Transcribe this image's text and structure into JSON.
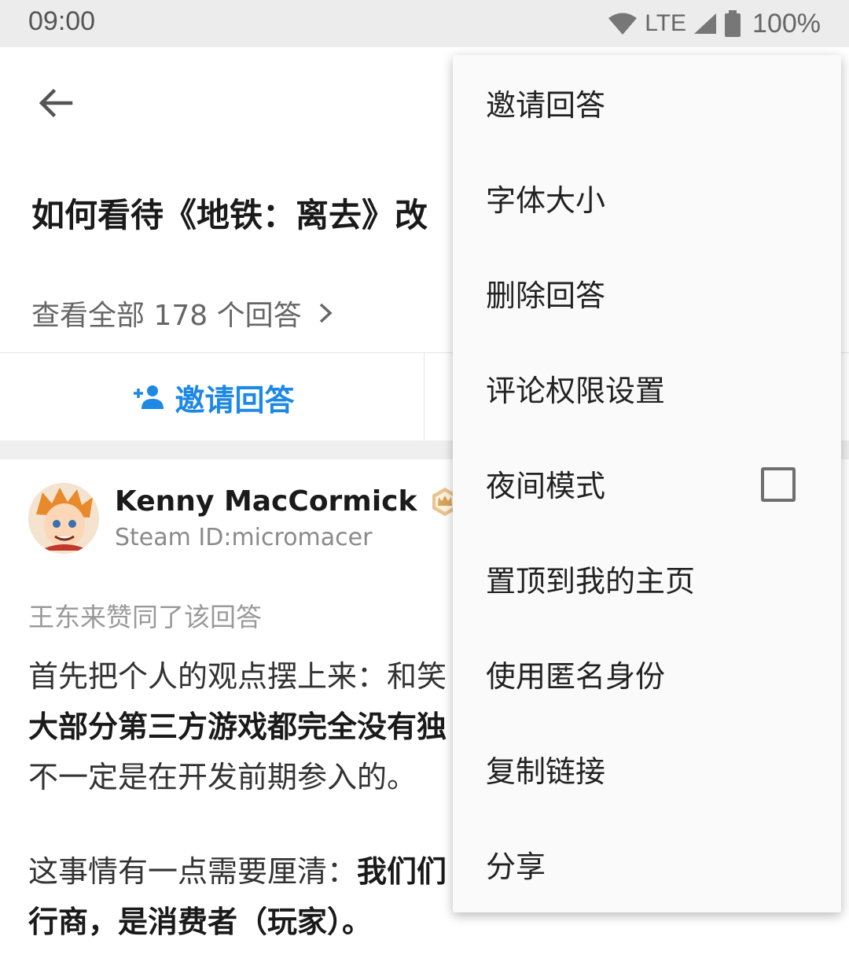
{
  "status_bar": {
    "time": "09:00",
    "network": "LTE",
    "battery": "100%"
  },
  "question": {
    "title": "如何看待《地铁：离去》改",
    "view_all": "查看全部 178 个回答"
  },
  "actions": {
    "invite_label": "邀请回答",
    "accent_color": "#1e88e5"
  },
  "author": {
    "name": "Kenny MacCormick",
    "bio": "Steam ID:micromacer"
  },
  "answer": {
    "voter_line": "王东来赞同了该回答",
    "paragraph1_line1": "首先把个人的观点摆上来：和笑",
    "paragraph1_line2": "大部分第三方游戏都完全没有独",
    "paragraph1_line3": "不一定是在开发前期参入的。",
    "paragraph2_line1_normal": "这事情有一点需要厘清：",
    "paragraph2_line1_bold": "我们们",
    "paragraph2_line2": "行商，是消费者（玩家）。"
  },
  "menu": {
    "items": [
      {
        "label": "邀请回答"
      },
      {
        "label": "字体大小"
      },
      {
        "label": "删除回答"
      },
      {
        "label": "评论权限设置"
      },
      {
        "label": "夜间模式"
      },
      {
        "label": "置顶到我的主页"
      },
      {
        "label": "使用匿名身份"
      },
      {
        "label": "复制链接"
      },
      {
        "label": "分享"
      }
    ],
    "night_mode_checked": false
  }
}
